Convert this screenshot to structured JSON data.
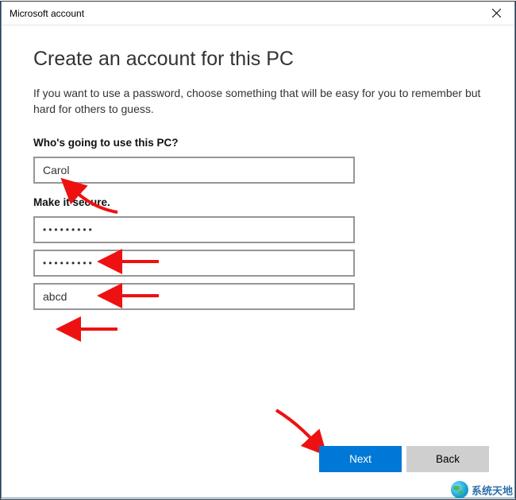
{
  "window": {
    "title": "Microsoft account"
  },
  "header": {
    "heading": "Create an account for this PC",
    "intro": "If you want to use a password, choose something that will be easy for you to remember but hard for others to guess."
  },
  "sections": {
    "who_label": "Who's going to use this PC?",
    "secure_label": "Make it secure."
  },
  "fields": {
    "username": {
      "value": "Carol"
    },
    "password": {
      "masked": "•••••••••"
    },
    "confirm_password": {
      "masked": "•••••••••"
    },
    "hint": {
      "value": "abcd"
    }
  },
  "buttons": {
    "next": "Next",
    "back": "Back"
  },
  "watermark": {
    "text": "系统天地"
  }
}
